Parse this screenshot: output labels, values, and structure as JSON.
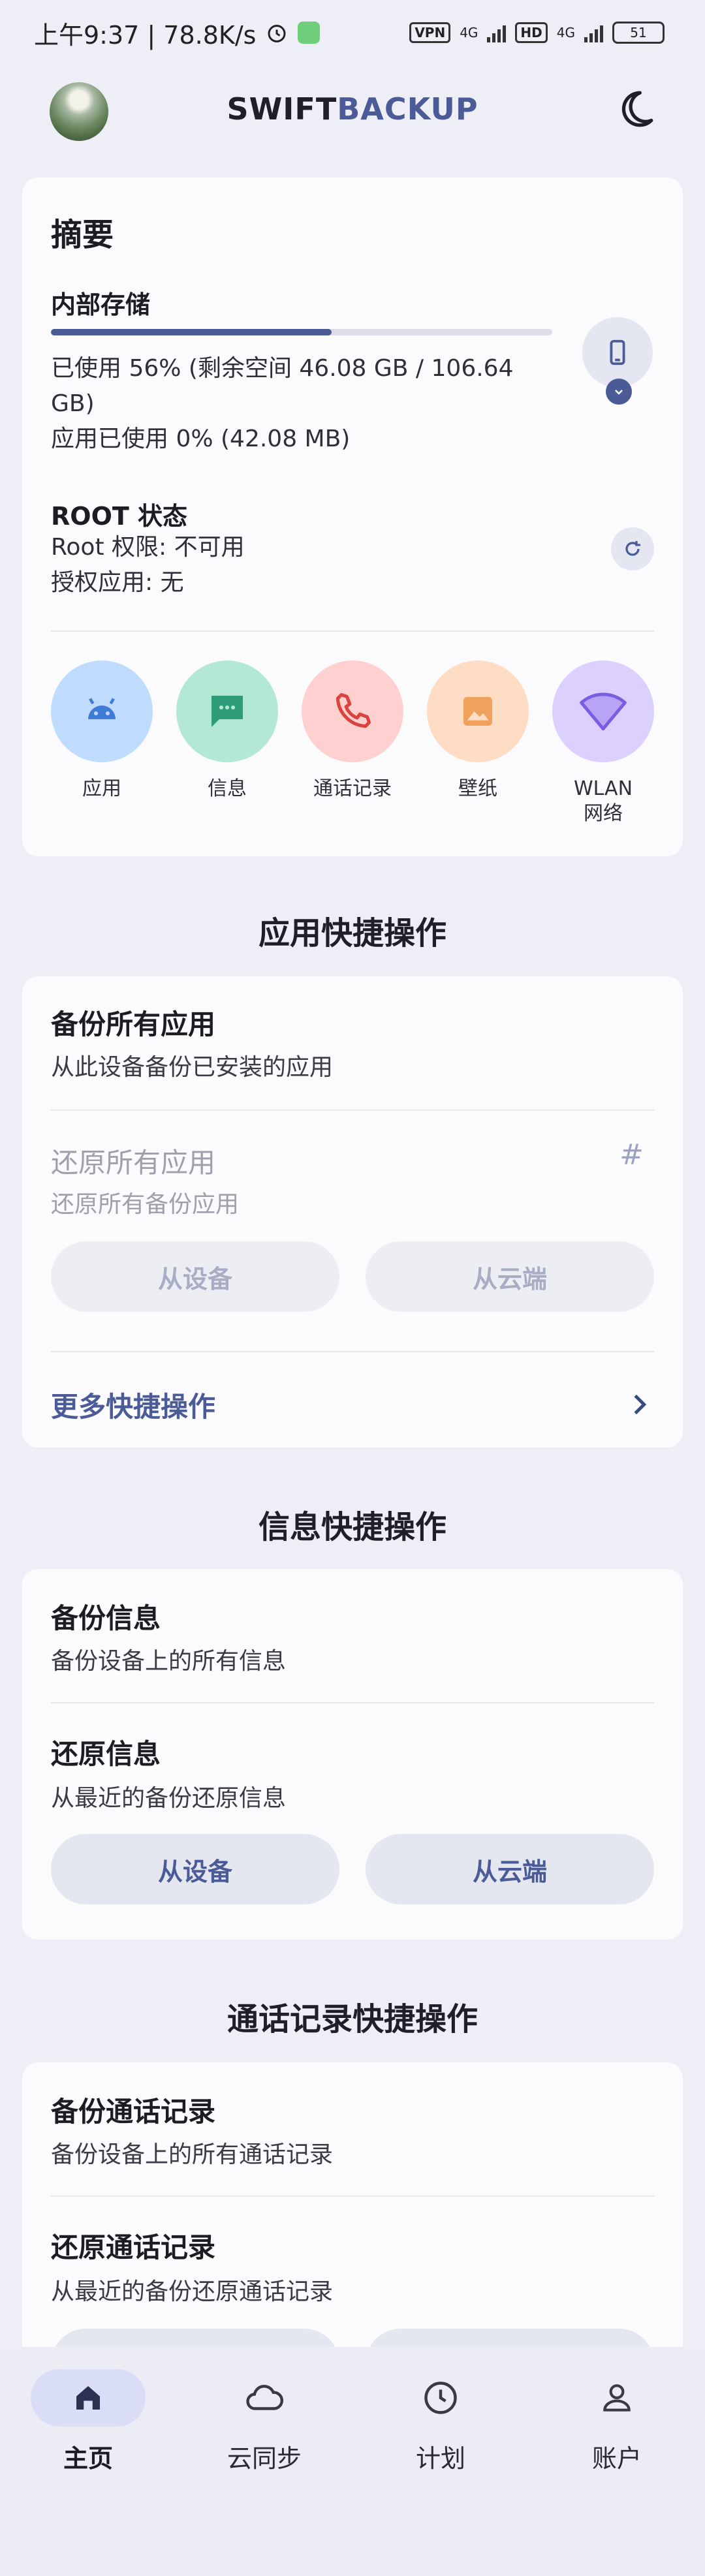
{
  "status_bar": {
    "time_speed": "上午9:37 | 78.8K/s",
    "vpn": "VPN",
    "net1": "4G",
    "hd": "HD",
    "net2": "4G",
    "battery": "51"
  },
  "app_bar": {
    "title_part1": "SWIFT",
    "title_part2": "BACKUP",
    "theme_icon": "moon-icon",
    "avatar": "profile-avatar"
  },
  "summary": {
    "title": "摘要",
    "storage_label": "内部存储",
    "storage_used_fraction": 0.56,
    "storage_used_line1": "已使用 56% (剩余空间 46.08 GB / 106.64",
    "storage_used_line2": "GB)",
    "apps_used": "应用已使用 0% (42.08 MB)",
    "root_label": "ROOT 状态",
    "root_permission": "Root 权限: 不可用",
    "authorized_apps": "授权应用: 无",
    "categories": [
      {
        "label": "应用",
        "icon": "android-icon",
        "color": "#bfdcff"
      },
      {
        "label": "信息",
        "icon": "message-icon",
        "color": "#b3e8d4"
      },
      {
        "label": "通话记录",
        "icon": "phone-icon",
        "color": "#ffd0d0"
      },
      {
        "label": "壁纸",
        "icon": "image-icon",
        "color": "#ffdcc4"
      },
      {
        "label": "WLAN",
        "label2": "网络",
        "icon": "wifi-icon",
        "color": "#dcd0ff"
      }
    ]
  },
  "app_actions": {
    "section_title": "应用快捷操作",
    "backup_title": "备份所有应用",
    "backup_sub": "从此设备备份已安装的应用",
    "restore_title": "还原所有应用",
    "restore_sub": "还原所有备份应用",
    "hash": "#",
    "from_device": "从设备",
    "from_cloud": "从云端",
    "more": "更多快捷操作"
  },
  "message_actions": {
    "section_title": "信息快捷操作",
    "backup_title": "备份信息",
    "backup_sub": "备份设备上的所有信息",
    "restore_title": "还原信息",
    "restore_sub": "从最近的备份还原信息",
    "from_device": "从设备",
    "from_cloud": "从云端"
  },
  "call_actions": {
    "section_title": "通话记录快捷操作",
    "backup_title": "备份通话记录",
    "backup_sub": "备份设备上的所有通话记录",
    "restore_title": "还原通话记录",
    "restore_sub": "从最近的备份还原通话记录"
  },
  "bottom_nav": {
    "items": [
      {
        "label": "主页",
        "icon": "home-icon",
        "active": true
      },
      {
        "label": "云同步",
        "icon": "cloud-icon",
        "active": false
      },
      {
        "label": "计划",
        "icon": "clock-icon",
        "active": false
      },
      {
        "label": "账户",
        "icon": "account-icon",
        "active": false
      }
    ]
  },
  "colors": {
    "accent": "#4a5b97",
    "background": "#eeeef6",
    "card": "#fbfbfd"
  }
}
